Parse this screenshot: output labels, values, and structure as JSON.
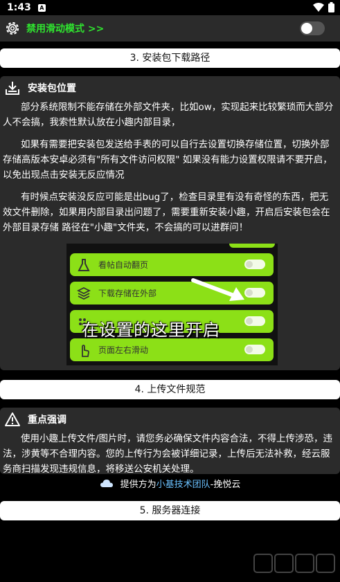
{
  "status_bar": {
    "time": "1:43"
  },
  "top_toggle": {
    "label": "禁用滑动模式 >>",
    "state": "off"
  },
  "sections": {
    "s3": "3. 安装包下载路径",
    "s4": "4. 上传文件规范",
    "s5": "5. 服务器连接"
  },
  "install_location": {
    "title": "安装包位置",
    "p1": "部分系统限制不能存储在外部文件夹，比如ow，实现起来比较繁琐而大部分人不会搞，我索性默认放在小趣内部目录，",
    "p2": "如果有需要把安装包发送给手表的可以自行去设置切换存储位置，切换外部存储高版本安卓必须有\"所有文件访问权限\" 如果没有能力设置权限请不要开启，以免出现点击安装无反应情况",
    "p3": "有时候点安装没反应可能是出bug了，检查目录里有没有奇怪的东西，把无效文件删除，如果用内部目录出问题了，需要重新安装小趣，开启后安装包会在外部目录存储 路径在\"小趣\"文件夹，不会搞的可以进群问！"
  },
  "inset_screenshot": {
    "rows": [
      {
        "label": "看帖自动翻页"
      },
      {
        "label": "下载存储在外部"
      },
      {
        "label": ""
      },
      {
        "label": "页面左右滑动"
      }
    ],
    "caption": "在设置的这里开启"
  },
  "upload_rules": {
    "title": "重点强调",
    "p1": "使用小趣上传文件/图片时，请您务必确保文件内容合法，不得上传涉恐，违法，涉黄等不合理内容。您的上传行为会被详细记录，上传后无法补救，经云服务商扫描发现违规信息，将移送公安机关处理。"
  },
  "provider": {
    "prefix": "提供方为",
    "team": "小基技术团队",
    "suffix": "-挽悦云"
  },
  "colors": {
    "accent_green": "#2fe32f",
    "card_bg": "#2b2b2b",
    "row_green": "#8ce017",
    "team_blue": "#6ac1ff"
  }
}
